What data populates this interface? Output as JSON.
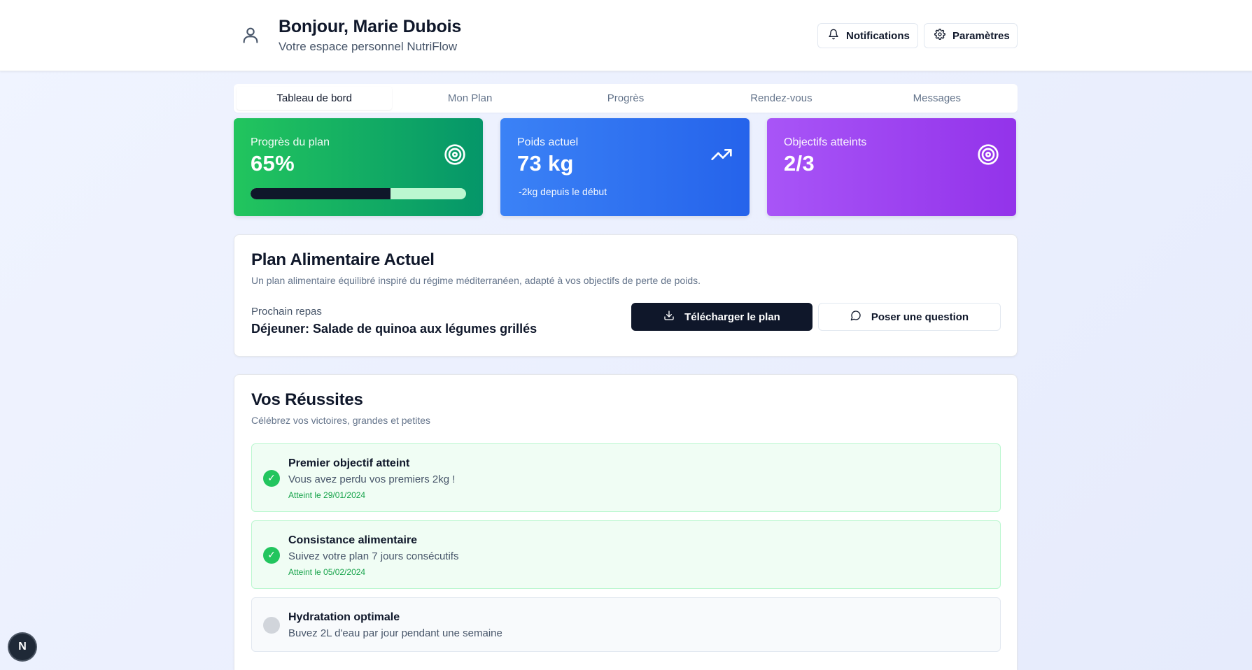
{
  "header": {
    "greeting": "Bonjour, Marie Dubois",
    "subtitle": "Votre espace personnel NutriFlow",
    "notifications_label": "Notifications",
    "settings_label": "Paramètres",
    "avatar_icon": "user-icon",
    "notifications_icon": "bell-icon",
    "settings_icon": "gear-icon"
  },
  "tabs": [
    {
      "label": "Tableau de bord",
      "active": true
    },
    {
      "label": "Mon Plan",
      "active": false
    },
    {
      "label": "Progrès",
      "active": false
    },
    {
      "label": "Rendez-vous",
      "active": false
    },
    {
      "label": "Messages",
      "active": false
    }
  ],
  "stats": {
    "progress": {
      "label": "Progrès du plan",
      "value": "65%",
      "progress_fraction": 0.65,
      "icon": "target-icon",
      "color": "#16a34a"
    },
    "weight": {
      "label": "Poids actuel",
      "value": "73 kg",
      "note": "-2kg depuis le début",
      "icon": "trending-up-icon",
      "color": "#2563eb"
    },
    "goals": {
      "label": "Objectifs atteints",
      "value": "2/3",
      "icon": "target-icon",
      "color": "#9333ea"
    }
  },
  "plan": {
    "title": "Plan Alimentaire Actuel",
    "description": "Un plan alimentaire équilibré inspiré du régime méditerranéen, adapté à vos objectifs de perte de poids.",
    "next_meal_label": "Prochain repas",
    "next_meal": "Déjeuner: Salade de quinoa aux légumes grillés",
    "download_label": "Télécharger le plan",
    "question_label": "Poser une question",
    "download_icon": "download-icon",
    "question_icon": "message-circle-icon"
  },
  "achievements": {
    "title": "Vos Réussites",
    "description": "Célébrez vos victoires, grandes et petites",
    "items": [
      {
        "title": "Premier objectif atteint",
        "text": "Vous avez perdu vos premiers 2kg !",
        "date": "Atteint le 29/01/2024",
        "done": true
      },
      {
        "title": "Consistance alimentaire",
        "text": "Suivez votre plan 7 jours consécutifs",
        "date": "Atteint le 05/02/2024",
        "done": true
      },
      {
        "title": "Hydratation optimale",
        "text": "Buvez 2L d'eau par jour pendant une semaine",
        "date": "",
        "done": false
      }
    ]
  },
  "floating_badge": {
    "label": "N"
  }
}
